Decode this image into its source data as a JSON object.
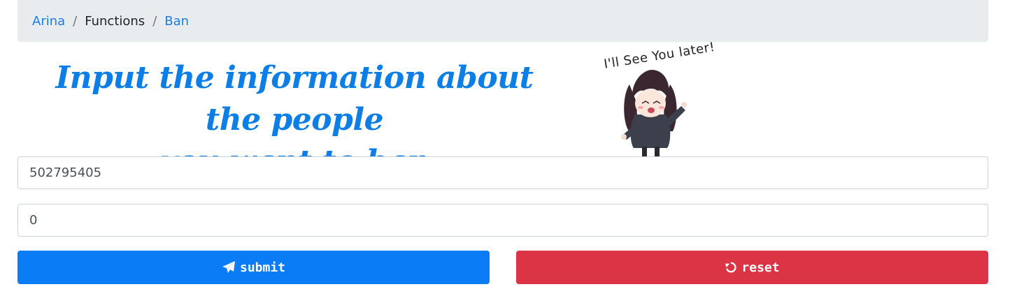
{
  "breadcrumb": {
    "items": [
      {
        "label": "Arina",
        "link": true
      },
      {
        "label": "Functions",
        "link": false
      },
      {
        "label": "Ban",
        "link": true
      }
    ],
    "separator": "/"
  },
  "headline": {
    "line1": "Input the information about the people",
    "line2": "you want to ban"
  },
  "sticker": {
    "text": "I'll See You later!",
    "icon": "anime-girl-waving-sticker"
  },
  "form": {
    "field1_value": "502795405",
    "field2_value": "0"
  },
  "buttons": {
    "submit_label": "submit",
    "submit_icon": "paper-plane-icon",
    "reset_label": "reset",
    "reset_icon": "undo-icon"
  },
  "colors": {
    "primary": "#0a7df6",
    "danger": "#db3545",
    "link": "#1a7ee6",
    "headline": "#0d7ee6",
    "breadcrumb_bg": "#e9ecef"
  }
}
